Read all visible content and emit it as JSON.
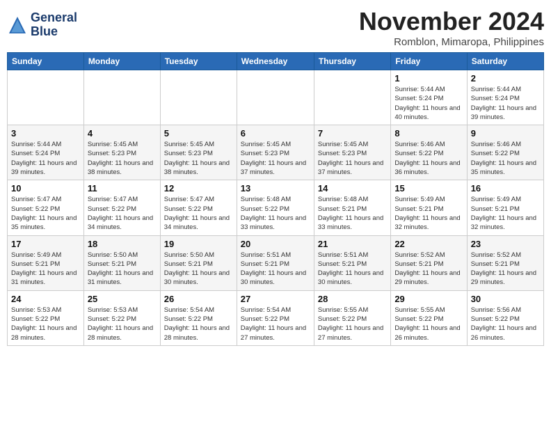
{
  "header": {
    "logo_line1": "General",
    "logo_line2": "Blue",
    "month": "November 2024",
    "location": "Romblon, Mimaropa, Philippines"
  },
  "days_of_week": [
    "Sunday",
    "Monday",
    "Tuesday",
    "Wednesday",
    "Thursday",
    "Friday",
    "Saturday"
  ],
  "weeks": [
    [
      {
        "day": "",
        "info": ""
      },
      {
        "day": "",
        "info": ""
      },
      {
        "day": "",
        "info": ""
      },
      {
        "day": "",
        "info": ""
      },
      {
        "day": "",
        "info": ""
      },
      {
        "day": "1",
        "info": "Sunrise: 5:44 AM\nSunset: 5:24 PM\nDaylight: 11 hours and 40 minutes."
      },
      {
        "day": "2",
        "info": "Sunrise: 5:44 AM\nSunset: 5:24 PM\nDaylight: 11 hours and 39 minutes."
      }
    ],
    [
      {
        "day": "3",
        "info": "Sunrise: 5:44 AM\nSunset: 5:24 PM\nDaylight: 11 hours and 39 minutes."
      },
      {
        "day": "4",
        "info": "Sunrise: 5:45 AM\nSunset: 5:23 PM\nDaylight: 11 hours and 38 minutes."
      },
      {
        "day": "5",
        "info": "Sunrise: 5:45 AM\nSunset: 5:23 PM\nDaylight: 11 hours and 38 minutes."
      },
      {
        "day": "6",
        "info": "Sunrise: 5:45 AM\nSunset: 5:23 PM\nDaylight: 11 hours and 37 minutes."
      },
      {
        "day": "7",
        "info": "Sunrise: 5:45 AM\nSunset: 5:23 PM\nDaylight: 11 hours and 37 minutes."
      },
      {
        "day": "8",
        "info": "Sunrise: 5:46 AM\nSunset: 5:22 PM\nDaylight: 11 hours and 36 minutes."
      },
      {
        "day": "9",
        "info": "Sunrise: 5:46 AM\nSunset: 5:22 PM\nDaylight: 11 hours and 35 minutes."
      }
    ],
    [
      {
        "day": "10",
        "info": "Sunrise: 5:47 AM\nSunset: 5:22 PM\nDaylight: 11 hours and 35 minutes."
      },
      {
        "day": "11",
        "info": "Sunrise: 5:47 AM\nSunset: 5:22 PM\nDaylight: 11 hours and 34 minutes."
      },
      {
        "day": "12",
        "info": "Sunrise: 5:47 AM\nSunset: 5:22 PM\nDaylight: 11 hours and 34 minutes."
      },
      {
        "day": "13",
        "info": "Sunrise: 5:48 AM\nSunset: 5:22 PM\nDaylight: 11 hours and 33 minutes."
      },
      {
        "day": "14",
        "info": "Sunrise: 5:48 AM\nSunset: 5:21 PM\nDaylight: 11 hours and 33 minutes."
      },
      {
        "day": "15",
        "info": "Sunrise: 5:49 AM\nSunset: 5:21 PM\nDaylight: 11 hours and 32 minutes."
      },
      {
        "day": "16",
        "info": "Sunrise: 5:49 AM\nSunset: 5:21 PM\nDaylight: 11 hours and 32 minutes."
      }
    ],
    [
      {
        "day": "17",
        "info": "Sunrise: 5:49 AM\nSunset: 5:21 PM\nDaylight: 11 hours and 31 minutes."
      },
      {
        "day": "18",
        "info": "Sunrise: 5:50 AM\nSunset: 5:21 PM\nDaylight: 11 hours and 31 minutes."
      },
      {
        "day": "19",
        "info": "Sunrise: 5:50 AM\nSunset: 5:21 PM\nDaylight: 11 hours and 30 minutes."
      },
      {
        "day": "20",
        "info": "Sunrise: 5:51 AM\nSunset: 5:21 PM\nDaylight: 11 hours and 30 minutes."
      },
      {
        "day": "21",
        "info": "Sunrise: 5:51 AM\nSunset: 5:21 PM\nDaylight: 11 hours and 30 minutes."
      },
      {
        "day": "22",
        "info": "Sunrise: 5:52 AM\nSunset: 5:21 PM\nDaylight: 11 hours and 29 minutes."
      },
      {
        "day": "23",
        "info": "Sunrise: 5:52 AM\nSunset: 5:21 PM\nDaylight: 11 hours and 29 minutes."
      }
    ],
    [
      {
        "day": "24",
        "info": "Sunrise: 5:53 AM\nSunset: 5:22 PM\nDaylight: 11 hours and 28 minutes."
      },
      {
        "day": "25",
        "info": "Sunrise: 5:53 AM\nSunset: 5:22 PM\nDaylight: 11 hours and 28 minutes."
      },
      {
        "day": "26",
        "info": "Sunrise: 5:54 AM\nSunset: 5:22 PM\nDaylight: 11 hours and 28 minutes."
      },
      {
        "day": "27",
        "info": "Sunrise: 5:54 AM\nSunset: 5:22 PM\nDaylight: 11 hours and 27 minutes."
      },
      {
        "day": "28",
        "info": "Sunrise: 5:55 AM\nSunset: 5:22 PM\nDaylight: 11 hours and 27 minutes."
      },
      {
        "day": "29",
        "info": "Sunrise: 5:55 AM\nSunset: 5:22 PM\nDaylight: 11 hours and 26 minutes."
      },
      {
        "day": "30",
        "info": "Sunrise: 5:56 AM\nSunset: 5:22 PM\nDaylight: 11 hours and 26 minutes."
      }
    ]
  ]
}
